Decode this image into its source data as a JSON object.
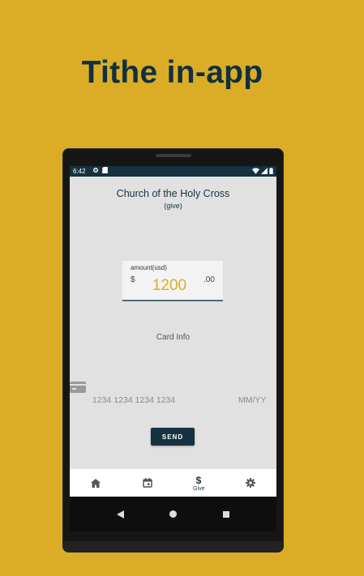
{
  "headline": "Tithe in-app",
  "status_bar": {
    "time": "6:42",
    "icons": [
      "settings-icon",
      "sd-card-icon",
      "wifi-icon",
      "signal-icon",
      "battery-icon"
    ]
  },
  "header": {
    "title": "Church of the Holy Cross",
    "subtitle": "(give)"
  },
  "amount": {
    "label": "amount(usd)",
    "currency_symbol": "$",
    "value": "1200",
    "cents": ".00"
  },
  "card": {
    "section_label": "Card Info",
    "number_placeholder": "1234 1234 1234 1234",
    "expiry_placeholder": "MM/YY"
  },
  "send_label": "SEND",
  "bottom_nav": {
    "items": [
      {
        "icon": "home-icon",
        "label": ""
      },
      {
        "icon": "calendar-icon",
        "label": ""
      },
      {
        "icon": "dollar-icon",
        "label": "Give",
        "active": true
      },
      {
        "icon": "gear-icon",
        "label": ""
      }
    ]
  },
  "system_nav": [
    "back-icon",
    "home-circle-icon",
    "recents-icon"
  ],
  "colors": {
    "background": "#DBAD27",
    "primary": "#16313F",
    "accent": "#DBAD27",
    "screen": "#E1E1E1"
  }
}
